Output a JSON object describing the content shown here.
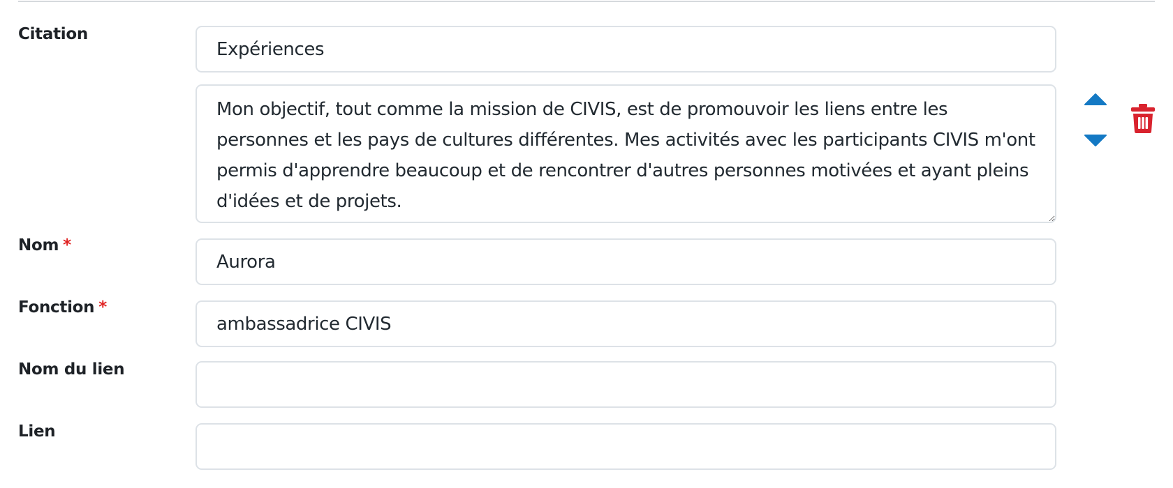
{
  "form": {
    "citation": {
      "label": "Citation",
      "title_value": "Expériences",
      "text_value": "Mon objectif, tout comme la mission de CIVIS, est de promouvoir les liens entre les personnes et les pays de cultures différentes. Mes activités avec les participants CIVIS m'ont permis d'apprendre beaucoup et de rencontrer d'autres personnes motivées et ayant pleins d'idées et de projets."
    },
    "nom": {
      "label": "Nom",
      "required_mark": "*",
      "value": "Aurora"
    },
    "fonction": {
      "label": "Fonction",
      "required_mark": "*",
      "value": "ambassadrice CIVIS"
    },
    "nom_du_lien": {
      "label": "Nom du lien",
      "value": ""
    },
    "lien": {
      "label": "Lien",
      "value": ""
    }
  },
  "controls": {
    "move_up_icon": "caret-up-icon",
    "move_down_icon": "caret-down-icon",
    "delete_icon": "trash-icon",
    "arrow_color": "#1479c4",
    "delete_color": "#d9232e"
  }
}
